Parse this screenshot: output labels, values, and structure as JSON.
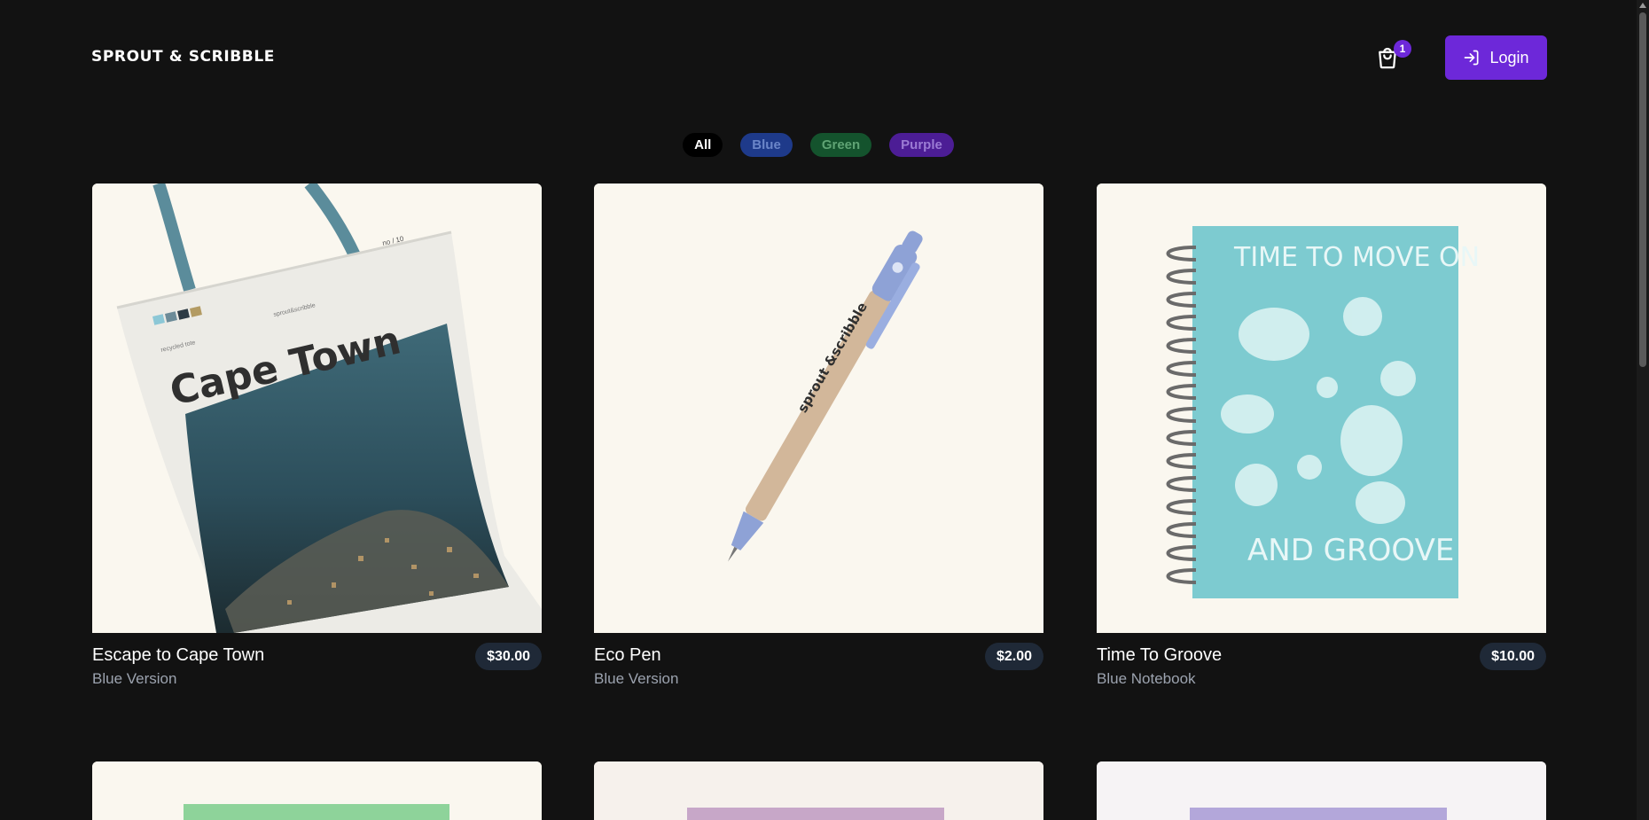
{
  "header": {
    "brand": "SPROUT & SCRIBBLE",
    "cart_count": "1",
    "login_label": "Login"
  },
  "filters": [
    {
      "label": "All",
      "active": true
    },
    {
      "label": "Blue"
    },
    {
      "label": "Green"
    },
    {
      "label": "Purple"
    }
  ],
  "products": [
    {
      "name": "Escape to Cape Town",
      "variant": "Blue Version",
      "price": "$30.00",
      "image_text": "Cape Town",
      "image_small_1": "recycled tote",
      "image_small_2": "sprout&scribble",
      "image_small_3": "no / 10"
    },
    {
      "name": "Eco Pen",
      "variant": "Blue Version",
      "price": "$2.00",
      "image_text": "sprout &scribble"
    },
    {
      "name": "Time To Groove",
      "variant": "Blue Notebook",
      "price": "$10.00",
      "image_text_top": "TIME TO MOVE ON",
      "image_text_bottom": "AND GROOVE"
    }
  ],
  "colors": {
    "background": "#121212",
    "accent": "#6d28d9",
    "card_bg": "#faf7ef",
    "price_pill": "#1f2937"
  }
}
